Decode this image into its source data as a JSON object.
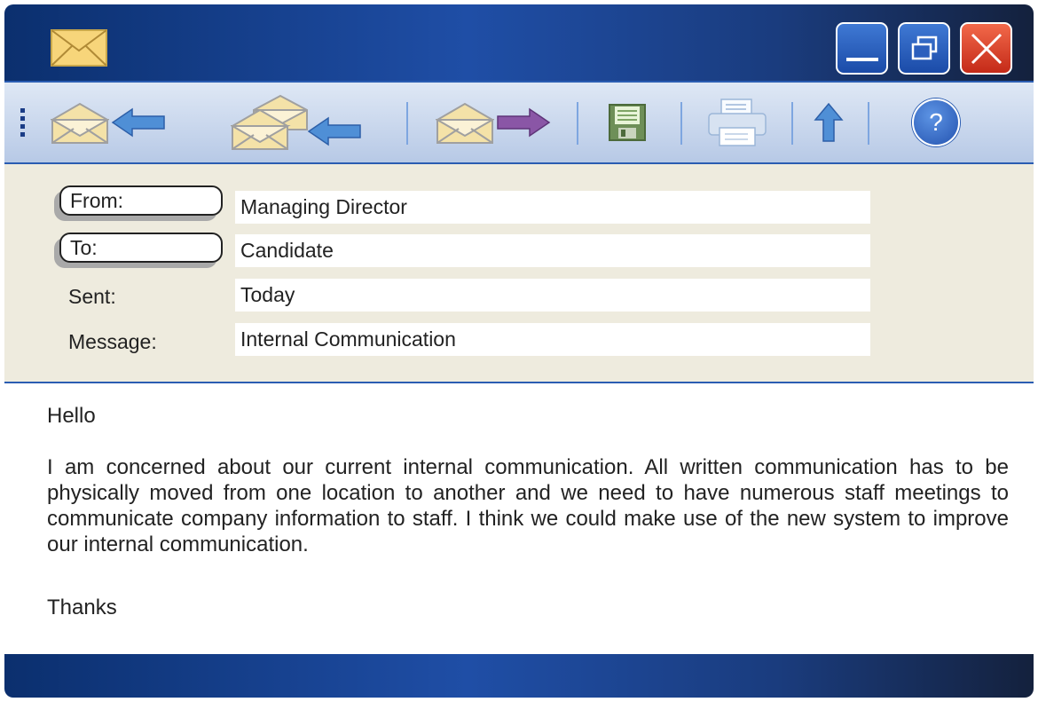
{
  "window": {
    "app_icon": "envelope-icon",
    "controls": {
      "minimize": "minimize-icon",
      "maximize": "restore-icon",
      "close": "close-icon"
    }
  },
  "toolbar": {
    "items": [
      {
        "name": "reply",
        "icons": [
          "envelope-icon",
          "arrow-left-icon"
        ]
      },
      {
        "name": "reply-all",
        "icons": [
          "envelopes-icon",
          "arrow-left-icon"
        ]
      },
      {
        "name": "forward",
        "icons": [
          "envelope-icon",
          "arrow-right-icon"
        ]
      },
      {
        "name": "save",
        "icons": [
          "floppy-disk-icon"
        ]
      },
      {
        "name": "print",
        "icons": [
          "printer-icon"
        ]
      },
      {
        "name": "up",
        "icons": [
          "arrow-up-icon"
        ]
      },
      {
        "name": "help",
        "icons": [
          "help-icon"
        ],
        "label": "?"
      }
    ]
  },
  "header": {
    "from": {
      "label": "From:",
      "value": "Managing Director"
    },
    "to": {
      "label": "To:",
      "value": "Candidate"
    },
    "sent": {
      "label": "Sent:",
      "value": "Today"
    },
    "message": {
      "label": "Message:",
      "value": "Internal Communication"
    }
  },
  "body": {
    "greeting": "Hello",
    "paragraph": "I am concerned about our current internal communication. All written communication has to be physically moved from one location to another and we need to have numerous staff meetings to communicate company information to staff. I think we could make use of the new system to improve our internal communication.",
    "signoff": "Thanks"
  },
  "colors": {
    "titlebar_dark": "#0b2f6e",
    "titlebar_mid": "#1f4ea6",
    "accent_blue": "#2b5db2",
    "close_red": "#d8412a",
    "header_bg": "#eeebde",
    "envelope_yellow": "#f3d67a"
  }
}
